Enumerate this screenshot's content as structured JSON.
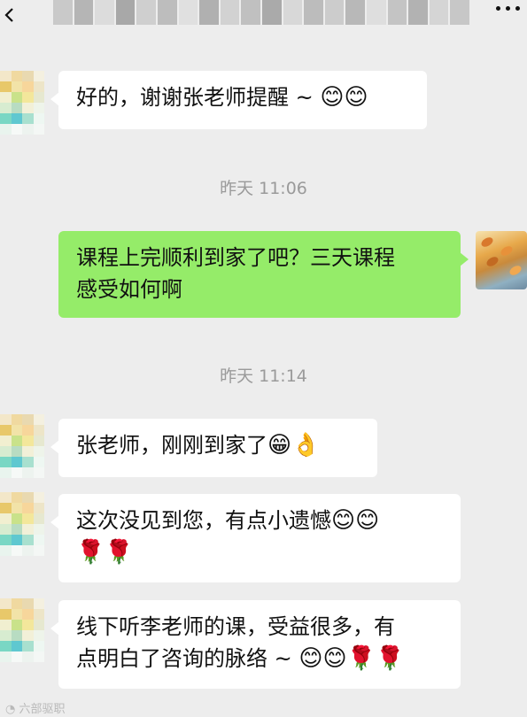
{
  "header": {
    "back_icon": "chevron-left-icon",
    "more_icon": "more-dots-icon",
    "title_blur_colors": [
      "#c9c9c9",
      "#b5b5b5",
      "#dcdcdc",
      "#a8a8a8",
      "#cfcfcf",
      "#bdbdbd",
      "#e0e0e0",
      "#b0b0b0",
      "#d2d2d2",
      "#c0c0c0",
      "#aaaaaa",
      "#d8d8d8",
      "#bcbcbc",
      "#cccccc",
      "#b8b8b8",
      "#dedede",
      "#c4c4c4",
      "#b2b2b2",
      "#d5d5d5",
      "#c7c7c7"
    ]
  },
  "avatar_colors": [
    "#f3e7c9",
    "#f0d9a0",
    "#e9d9b0",
    "#f4f0e0",
    "#e8c86a",
    "#f2e3a8",
    "#f7d69b",
    "#ede5c8",
    "#f1efd0",
    "#c9e28a",
    "#f3e79b",
    "#e6e8d0",
    "#d7ecd0",
    "#b8dcc2",
    "#f2f0d8",
    "#eef4ea",
    "#79d7c4",
    "#5fc8d0",
    "#a8e0cf",
    "#eef7f2",
    "#e9f4ee",
    "#f6f9f7",
    "#edf3ef",
    "#f4f7f5"
  ],
  "messages": [
    {
      "side": "left",
      "text": "好的，谢谢张老师提醒 ~ ",
      "emoji": "😊😊"
    },
    {
      "type": "time",
      "text": "昨天 11:06"
    },
    {
      "side": "right",
      "line1": "课程上完顺利到家了吧？三天课程",
      "line2": "感受如何啊"
    },
    {
      "type": "time",
      "text": "昨天 11:14"
    },
    {
      "side": "left",
      "text": "张老师，刚刚到家了",
      "emoji": "😁👌"
    },
    {
      "side": "left",
      "line1": "这次没见到您，有点小遗憾",
      "emoji1": "😊😊",
      "line2_emoji": "🌹🌹"
    },
    {
      "side": "left",
      "line1": "线下听李老师的课，受益很多，有",
      "line2": "点明白了咨询的脉络 ~ ",
      "emoji": "😊😊🌹🌹"
    }
  ],
  "watermark": "六部驱职"
}
